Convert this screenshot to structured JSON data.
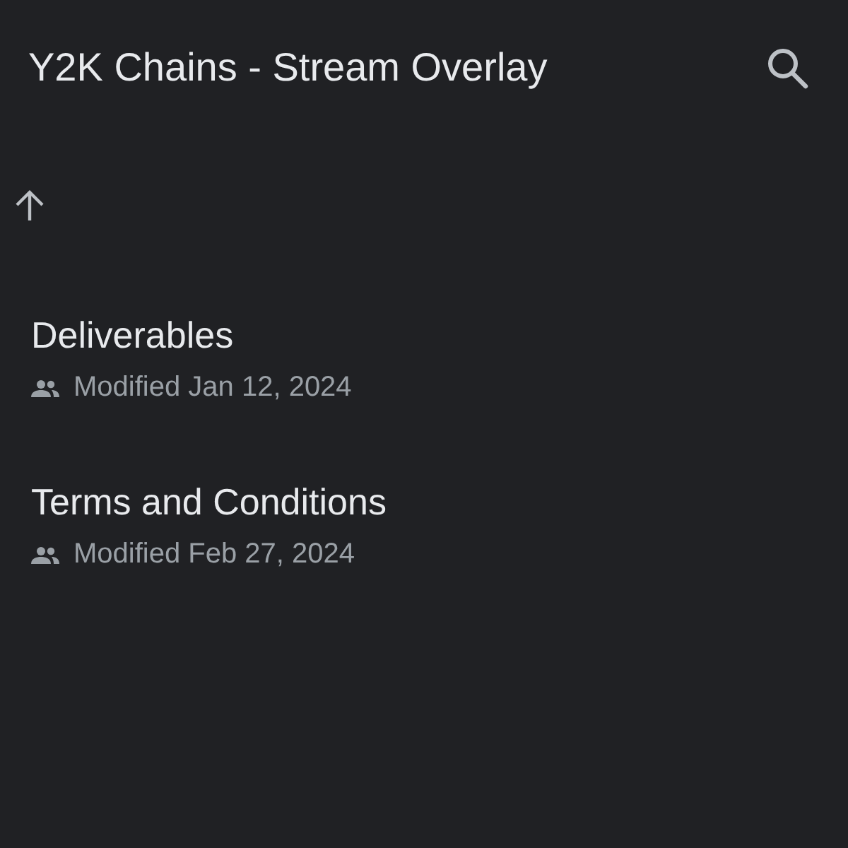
{
  "header": {
    "title": "Y2K Chains - Stream Overlay"
  },
  "files": [
    {
      "name": "Deliverables",
      "shared": true,
      "modified": "Modified Jan 12, 2024"
    },
    {
      "name": "Terms and Conditions",
      "shared": true,
      "modified": "Modified Feb 27, 2024"
    }
  ]
}
